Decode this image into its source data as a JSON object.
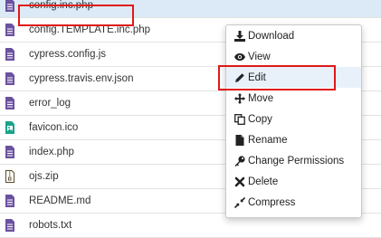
{
  "files": [
    {
      "name": "config.inc.php",
      "icon": "document-icon",
      "selected": true
    },
    {
      "name": "config.TEMPLATE.inc.php",
      "icon": "document-icon",
      "selected": false
    },
    {
      "name": "cypress.config.js",
      "icon": "document-icon",
      "selected": false
    },
    {
      "name": "cypress.travis.env.json",
      "icon": "document-icon",
      "selected": false
    },
    {
      "name": "error_log",
      "icon": "document-icon",
      "selected": false
    },
    {
      "name": "favicon.ico",
      "icon": "image-file-icon",
      "selected": false
    },
    {
      "name": "index.php",
      "icon": "document-icon",
      "selected": false
    },
    {
      "name": "ojs.zip",
      "icon": "archive-file-icon",
      "selected": false
    },
    {
      "name": "README.md",
      "icon": "document-icon",
      "selected": false
    },
    {
      "name": "robots.txt",
      "icon": "document-icon",
      "selected": false
    }
  ],
  "context_menu": {
    "items": [
      {
        "label": "Download",
        "icon": "download-icon"
      },
      {
        "label": "View",
        "icon": "eye-icon"
      },
      {
        "label": "Edit",
        "icon": "pencil-icon",
        "active": true
      },
      {
        "label": "Move",
        "icon": "move-arrows-icon"
      },
      {
        "label": "Copy",
        "icon": "copy-icon"
      },
      {
        "label": "Rename",
        "icon": "rename-file-icon"
      },
      {
        "label": "Change Permissions",
        "icon": "key-icon"
      },
      {
        "label": "Delete",
        "icon": "x-icon"
      },
      {
        "label": "Compress",
        "icon": "compress-icon"
      }
    ]
  },
  "colors": {
    "file_icon": "#6b52a0",
    "image_icon": "#1aa38a",
    "highlight": "#e01818",
    "selected_row": "#dbeaf6",
    "menu_active": "#e8f1f9"
  }
}
